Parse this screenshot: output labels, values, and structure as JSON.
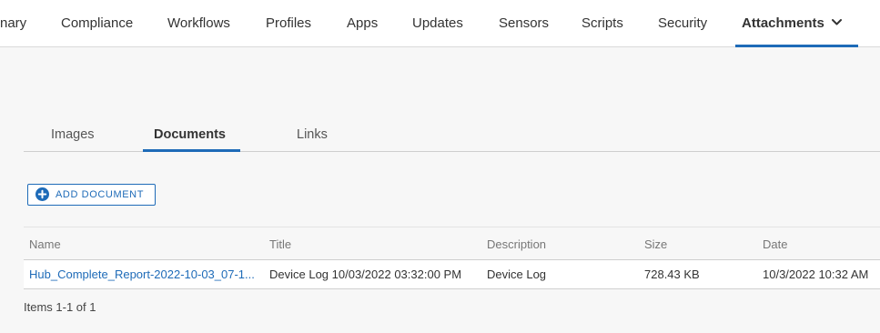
{
  "nav": {
    "tabs": [
      {
        "label": "nary"
      },
      {
        "label": "Compliance"
      },
      {
        "label": "Workflows"
      },
      {
        "label": "Profiles"
      },
      {
        "label": "Apps"
      },
      {
        "label": "Updates"
      },
      {
        "label": "Sensors"
      },
      {
        "label": "Scripts"
      },
      {
        "label": "Security"
      },
      {
        "label": "Attachments"
      }
    ],
    "active_tab": "Attachments"
  },
  "subtabs": {
    "items": [
      {
        "label": "Images"
      },
      {
        "label": "Documents"
      },
      {
        "label": "Links"
      }
    ],
    "active": "Documents"
  },
  "add_button": {
    "label": "ADD DOCUMENT",
    "icon": "plus-circle-icon"
  },
  "table": {
    "columns": [
      "Name",
      "Title",
      "Description",
      "Size",
      "Date"
    ],
    "rows": [
      {
        "name": "Hub_Complete_Report-2022-10-03_07-1...",
        "title": "Device Log 10/03/2022 03:32:00 PM",
        "description": "Device Log",
        "size": "728.43 KB",
        "date": "10/3/2022 10:32 AM"
      }
    ]
  },
  "pager": {
    "text": "Items 1-1 of 1"
  },
  "colors": {
    "accent": "#1e6bb8",
    "background": "#f7f7f7",
    "surface": "#ffffff",
    "header_text": "#777777"
  }
}
